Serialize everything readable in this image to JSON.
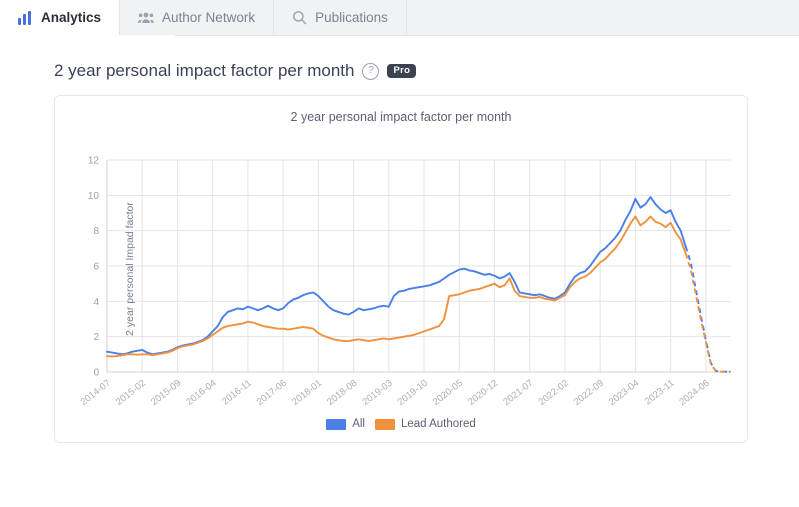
{
  "tabs": [
    {
      "label": "Analytics",
      "icon": "bar-chart-icon",
      "active": true
    },
    {
      "label": "Author Network",
      "icon": "people-group-icon",
      "active": false
    },
    {
      "label": "Publications",
      "icon": "search-icon",
      "active": false
    }
  ],
  "header": {
    "title": "2 year personal impact factor per month",
    "help_icon": "help-circle-icon",
    "help_glyph": "?",
    "badge": "Pro"
  },
  "colors": {
    "all": "#4a7fe8",
    "lead": "#f0913e",
    "grid": "#e2e4e8",
    "axis_text": "#9aa1ad",
    "card_border": "#e4e6ea",
    "tab_active_bg": "#ffffff",
    "tab_inactive_bg": "#f1f2f4",
    "badge_bg": "#3b4250"
  },
  "chart_data": {
    "type": "line",
    "title": "2 year personal impact factor per month",
    "xlabel": "",
    "ylabel": "2 year personal Impad factor",
    "ylim": [
      0,
      12
    ],
    "yticks": [
      0,
      2,
      4,
      6,
      8,
      10,
      12
    ],
    "grid": true,
    "legend_position": "bottom",
    "xtick_labels": [
      "2014-07",
      "2015-02",
      "2015-09",
      "2016-04",
      "2016-11",
      "2017-06",
      "2018-01",
      "2018-08",
      "2019-03",
      "2019-10",
      "2020-05",
      "2020-12",
      "2021-07",
      "2022-02",
      "2022-09",
      "2023-04",
      "2023-11",
      "2024-06"
    ],
    "xtick_step_months": 7,
    "x_start": "2014-07",
    "x_end": "2024-11",
    "forecast_starts_at": "2024-02",
    "forecast_note": "dashed segment at the end of both series",
    "x": [
      "2014-07",
      "2014-08",
      "2014-09",
      "2014-10",
      "2014-11",
      "2014-12",
      "2015-01",
      "2015-02",
      "2015-03",
      "2015-04",
      "2015-05",
      "2015-06",
      "2015-07",
      "2015-08",
      "2015-09",
      "2015-10",
      "2015-11",
      "2015-12",
      "2016-01",
      "2016-02",
      "2016-03",
      "2016-04",
      "2016-05",
      "2016-06",
      "2016-07",
      "2016-08",
      "2016-09",
      "2016-10",
      "2016-11",
      "2016-12",
      "2017-01",
      "2017-02",
      "2017-03",
      "2017-04",
      "2017-05",
      "2017-06",
      "2017-07",
      "2017-08",
      "2017-09",
      "2017-10",
      "2017-11",
      "2017-12",
      "2018-01",
      "2018-02",
      "2018-03",
      "2018-04",
      "2018-05",
      "2018-06",
      "2018-07",
      "2018-08",
      "2018-09",
      "2018-10",
      "2018-11",
      "2018-12",
      "2019-01",
      "2019-02",
      "2019-03",
      "2019-04",
      "2019-05",
      "2019-06",
      "2019-07",
      "2019-08",
      "2019-09",
      "2019-10",
      "2019-11",
      "2019-12",
      "2020-01",
      "2020-02",
      "2020-03",
      "2020-04",
      "2020-05",
      "2020-06",
      "2020-07",
      "2020-08",
      "2020-09",
      "2020-10",
      "2020-11",
      "2020-12",
      "2021-01",
      "2021-02",
      "2021-03",
      "2021-04",
      "2021-05",
      "2021-06",
      "2021-07",
      "2021-08",
      "2021-09",
      "2021-10",
      "2021-11",
      "2021-12",
      "2022-01",
      "2022-02",
      "2022-03",
      "2022-04",
      "2022-05",
      "2022-06",
      "2022-07",
      "2022-08",
      "2022-09",
      "2022-10",
      "2022-11",
      "2022-12",
      "2023-01",
      "2023-02",
      "2023-03",
      "2023-04",
      "2023-05",
      "2023-06",
      "2023-07",
      "2023-08",
      "2023-09",
      "2023-10",
      "2023-11",
      "2023-12",
      "2024-01",
      "2024-02",
      "2024-03",
      "2024-04",
      "2024-05",
      "2024-06",
      "2024-07",
      "2024-08",
      "2024-09",
      "2024-10",
      "2024-11"
    ],
    "series": [
      {
        "name": "All",
        "color": "#4a7fe8",
        "values": [
          1.15,
          1.1,
          1.05,
          1.0,
          1.05,
          1.15,
          1.2,
          1.25,
          1.1,
          1.0,
          1.05,
          1.1,
          1.15,
          1.25,
          1.4,
          1.5,
          1.55,
          1.6,
          1.7,
          1.8,
          2.0,
          2.3,
          2.6,
          3.1,
          3.4,
          3.5,
          3.6,
          3.55,
          3.7,
          3.6,
          3.5,
          3.6,
          3.75,
          3.6,
          3.5,
          3.6,
          3.9,
          4.1,
          4.2,
          4.35,
          4.45,
          4.5,
          4.3,
          4.0,
          3.7,
          3.5,
          3.4,
          3.3,
          3.25,
          3.4,
          3.6,
          3.5,
          3.55,
          3.6,
          3.7,
          3.75,
          3.7,
          4.3,
          4.55,
          4.6,
          4.7,
          4.75,
          4.8,
          4.85,
          4.9,
          5.0,
          5.1,
          5.3,
          5.5,
          5.65,
          5.8,
          5.85,
          5.75,
          5.7,
          5.6,
          5.5,
          5.55,
          5.45,
          5.3,
          5.4,
          5.6,
          5.1,
          4.5,
          4.45,
          4.4,
          4.35,
          4.4,
          4.3,
          4.2,
          4.15,
          4.3,
          4.5,
          5.0,
          5.4,
          5.6,
          5.7,
          6.0,
          6.4,
          6.8,
          7.0,
          7.3,
          7.6,
          8.0,
          8.6,
          9.1,
          9.8,
          9.3,
          9.5,
          9.9,
          9.5,
          9.2,
          9.0,
          9.15,
          8.5,
          8.0,
          7.1,
          6.2,
          4.7,
          3.2,
          1.8,
          0.5,
          0.05,
          0.02,
          0.02,
          0.02
        ]
      },
      {
        "name": "Lead Authored",
        "color": "#f0913e",
        "values": [
          0.9,
          0.88,
          0.9,
          0.95,
          1.0,
          1.0,
          0.98,
          1.0,
          1.0,
          0.95,
          1.0,
          1.05,
          1.1,
          1.2,
          1.35,
          1.45,
          1.5,
          1.55,
          1.65,
          1.75,
          1.9,
          2.1,
          2.3,
          2.5,
          2.6,
          2.65,
          2.7,
          2.75,
          2.85,
          2.8,
          2.7,
          2.6,
          2.55,
          2.5,
          2.45,
          2.45,
          2.4,
          2.45,
          2.5,
          2.55,
          2.5,
          2.45,
          2.2,
          2.05,
          1.95,
          1.85,
          1.8,
          1.75,
          1.75,
          1.8,
          1.85,
          1.8,
          1.75,
          1.8,
          1.85,
          1.9,
          1.85,
          1.9,
          1.95,
          2.0,
          2.05,
          2.1,
          2.2,
          2.3,
          2.4,
          2.5,
          2.6,
          3.0,
          4.3,
          4.35,
          4.4,
          4.5,
          4.6,
          4.65,
          4.7,
          4.8,
          4.9,
          5.0,
          4.8,
          4.9,
          5.3,
          4.6,
          4.3,
          4.25,
          4.2,
          4.2,
          4.25,
          4.15,
          4.1,
          4.05,
          4.2,
          4.35,
          4.8,
          5.1,
          5.3,
          5.4,
          5.6,
          5.9,
          6.2,
          6.4,
          6.7,
          7.0,
          7.4,
          7.9,
          8.4,
          8.8,
          8.3,
          8.5,
          8.8,
          8.5,
          8.4,
          8.2,
          8.45,
          7.9,
          7.5,
          6.7,
          5.8,
          4.4,
          3.0,
          1.7,
          0.45,
          0.04,
          0.02,
          0.02,
          0.02
        ]
      }
    ]
  }
}
